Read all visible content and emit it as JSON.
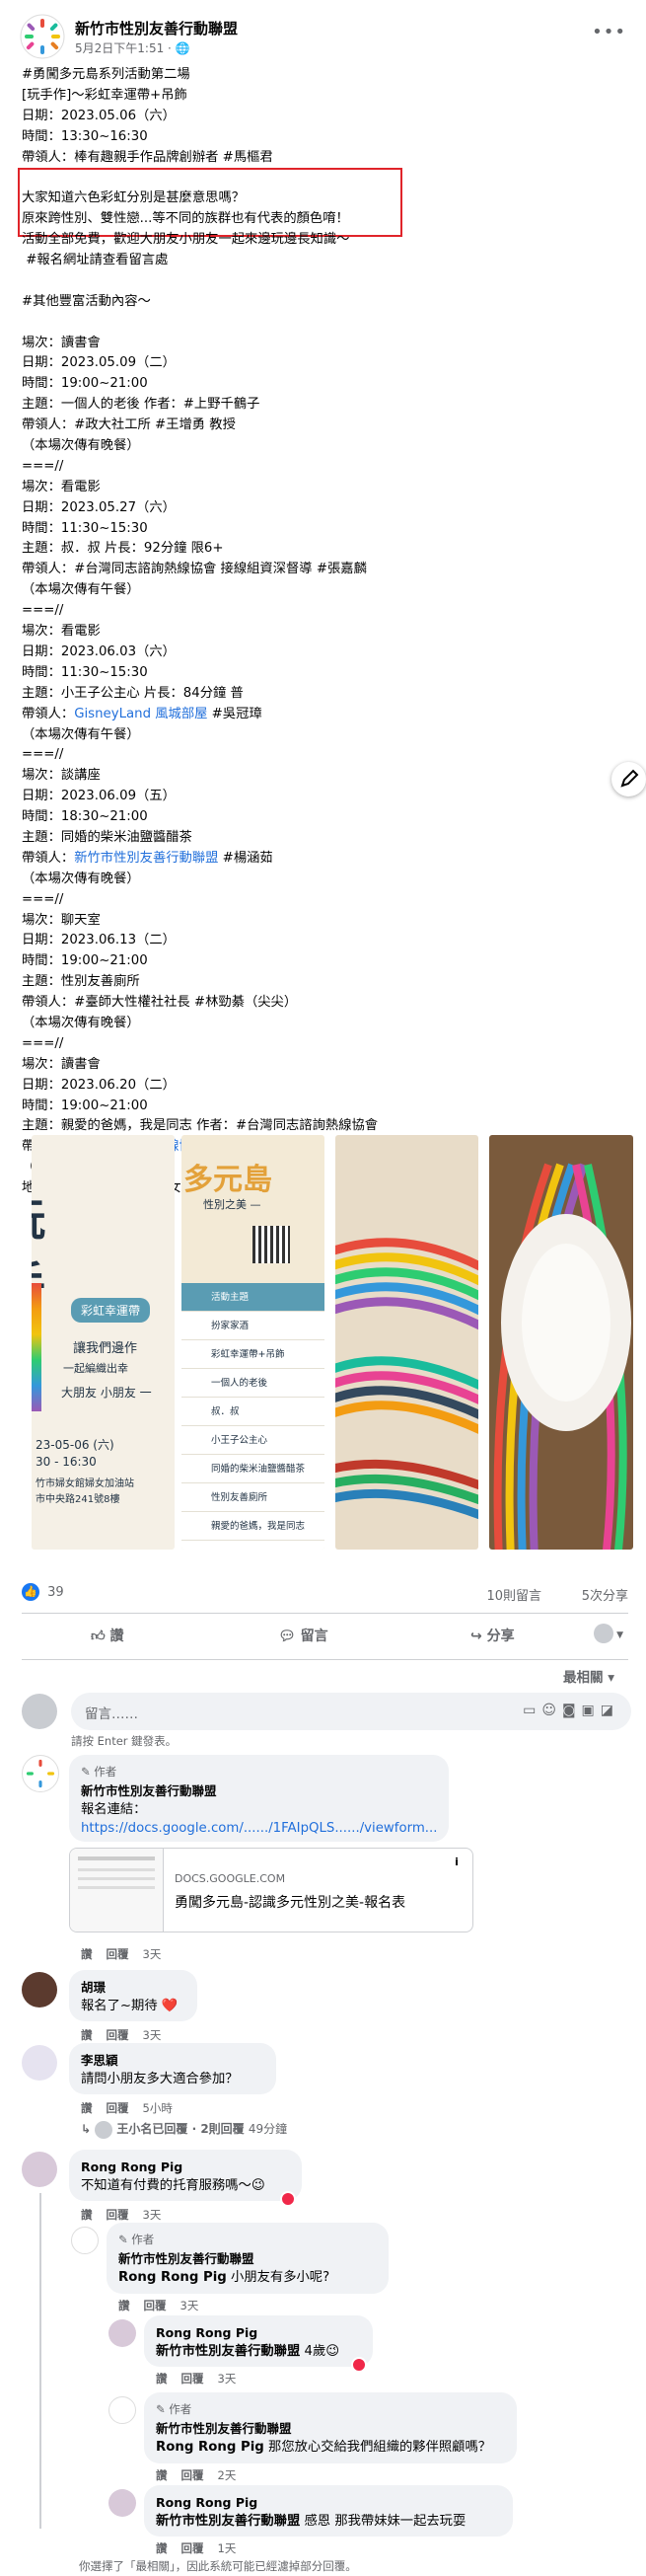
{
  "post": {
    "page_name": "新竹市性別友善行動聯盟",
    "meta": "5月2日下午1:51 · ",
    "globe": "🌐",
    "more": "•••",
    "body_lines": [
      "#勇闖多元島系列活動第二場",
      "[玩手作]～彩虹幸運帶+吊飾",
      "日期：2023.05.06（六）",
      "時間：13:30~16:30",
      "帶領人：棒有趣親手作品牌創辦者 #馬樞君",
      "",
      "大家知道六色彩虹分別是甚麼意思嗎？",
      "原來跨性別、雙性戀...等不同的族群也有代表的顏色唷！",
      "活動全部免費，歡迎大朋友小朋友一起來邊玩邊長知識～",
      " #報名網址請查看留言處",
      "",
      "#其他豐富活動內容～",
      "",
      "場次：讀書會",
      "日期：2023.05.09（二）",
      "時間：19:00~21:00",
      "主題：一個人的老後 作者：#上野千鶴子",
      "帶領人：#政大社工所 #王增勇 教授",
      "（本場次傳有晚餐）",
      "===//",
      "場次：看電影",
      "日期：2023.05.27（六）",
      "時間：11:30~15:30",
      "主題：叔．叔 片長：92分鐘 限6+",
      "帶領人：#台灣同志諮詢熱線協會 接線組資深督導 #張嘉麟",
      "（本場次傳有午餐）",
      "===//",
      "場次：看電影",
      "日期：2023.06.03（六）",
      "時間：11:30~15:30",
      "主題：小王子公主心 片長：84分鐘 普",
      "帶領人：GisneyLand 風城部屋 #吳冠璋",
      "（本場次傳有午餐）",
      "===//",
      "場次：談講座",
      "日期：2023.06.09（五）",
      "時間：18:30~21:00",
      "主題：同婚的柴米油鹽醬醋茶",
      "帶領人：新竹市性別友善行動聯盟 #楊涵茹",
      "（本場次傳有晚餐）",
      "===//",
      "場次：聊天室",
      "日期：2023.06.13（二）",
      "時間：19:00~21:00",
      "主題：性別友善廁所",
      "帶領人：#臺師大性權社社長 #林勁綦（尖尖）",
      "（本場次傳有晚餐）",
      "===//",
      "場次：讀書會",
      "日期：2023.06.20（二）",
      "時間：19:00~21:00",
      "主題：親愛的爸媽，我是同志 作者：#台灣同志諮詢熱線協會",
      "帶領人：台灣同志諮詢熱線協會 #許欣瑞",
      "（本場次傳有晚餐）",
      "地點：新竹市婦女館 #婦女加油站"
    ]
  },
  "photos": {
    "p1": {
      "big": "玩 手",
      "tag": "彩虹幸運帶",
      "lines": [
        "讓我們邊作",
        "一起編織出幸",
        "大朋友 小朋友 一"
      ],
      "date": "23-05-06 (六)",
      "time": "30 - 16:30",
      "place": [
        "竹市婦女館婦女加油站",
        "市中央路241號8樓"
      ]
    },
    "p2": {
      "title": "多元島",
      "sub": "性別之美 —",
      "rows": [
        "活動主題",
        "扮家家酒",
        "彩虹幸運帶+吊飾",
        "一個人的老後",
        "叔．叔",
        "小王子公主心",
        "同婚的柴米油鹽醬醋茶",
        "性別友善廁所",
        "親愛的爸媽，我是同志"
      ]
    }
  },
  "stats": {
    "likes": "39",
    "comments": "10則留言",
    "shares": "5次分享"
  },
  "actions": {
    "like": "讚",
    "comment": "留言",
    "share": "分享"
  },
  "comments_ui": {
    "sort": "最相關 ▾",
    "placeholder": "留言……",
    "hint": "請按 Enter 鍵發表。",
    "footnote": "你選擇了「最相關」，因此系統可能已經濾掉部分回覆。"
  },
  "comments": [
    {
      "author_badge": "作者",
      "name": "新竹市性別友善行動聯盟",
      "text": "報名連結：",
      "link": "https://docs.google.com/....../1FAIpQLS....../viewform.....",
      "preview_domain": "DOCS.GOOGLE.COM",
      "preview_title": "勇闖多元島-認識多元性別之美-報名表",
      "actions": [
        "讚",
        "回覆",
        "3天"
      ]
    },
    {
      "name": "胡璟",
      "text": "報名了~期待 ❤️",
      "actions": [
        "讚",
        "回覆",
        "3天"
      ]
    },
    {
      "name": "李思穎",
      "text": "請問小朋友多大適合參加？",
      "actions": [
        "讚",
        "回覆",
        "5小時"
      ],
      "reply_summary": "王小名已回覆 · 2則回覆",
      "reply_time": "49分鐘"
    },
    {
      "name": "Rong Rong Pig",
      "text": "不知道有付費的托育服務嗎～😉",
      "actions": [
        "讚",
        "回覆",
        "3天"
      ]
    },
    {
      "author_badge": "作者",
      "name": "新竹市性別友善行動聯盟",
      "tag": "Rong Rong Pig",
      "text": " 小朋友有多小呢?",
      "actions": [
        "讚",
        "回覆",
        "3天"
      ]
    },
    {
      "name": "Rong Rong Pig",
      "tag": "新竹市性別友善行動聯盟",
      "text": " 4歲😉",
      "actions": [
        "讚",
        "回覆",
        "3天"
      ]
    },
    {
      "author_badge": "作者",
      "name": "新竹市性別友善行動聯盟",
      "tag": "Rong Rong Pig",
      "text": " 那您放心交給我們組織的夥伴照顧嗎？",
      "actions": [
        "讚",
        "回覆",
        "2天"
      ]
    },
    {
      "name": "Rong Rong Pig",
      "tag": "新竹市性別友善行動聯盟",
      "text": " 感恩 那我帶妹妹一起去玩耍",
      "actions": [
        "讚",
        "回覆",
        "1天"
      ]
    }
  ],
  "colors": {
    "accent": "#1877f2",
    "highlight_box": "#e0242a",
    "link": "#216fdb"
  }
}
